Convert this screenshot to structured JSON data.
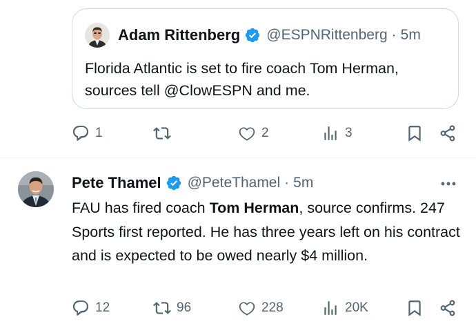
{
  "quoted_tweet": {
    "author_name": "Adam Rittenberg",
    "handle": "@ESPNRittenberg",
    "separator": "·",
    "time": "5m",
    "text": "Florida Atlantic is set to fire coach Tom Herman, sources tell @ClowESPN and me."
  },
  "quote_actions": {
    "replies": "1",
    "retweets": "",
    "likes": "2",
    "views": "3"
  },
  "tweet": {
    "author_name": "Pete Thamel",
    "handle": "@PeteThamel",
    "separator": "·",
    "time": "5m",
    "text_part1": "FAU has fired coach ",
    "text_bold": "Tom Herman",
    "text_part2": ", source confirms. 247 Sports first reported. He has three years left on his contract and is expected to be owed nearly $4 million."
  },
  "tweet_actions": {
    "replies": "12",
    "retweets": "96",
    "likes": "228",
    "views": "20K"
  },
  "colors": {
    "verified": "#1d9bf0",
    "muted": "#536471",
    "border": "#cfd9de"
  }
}
